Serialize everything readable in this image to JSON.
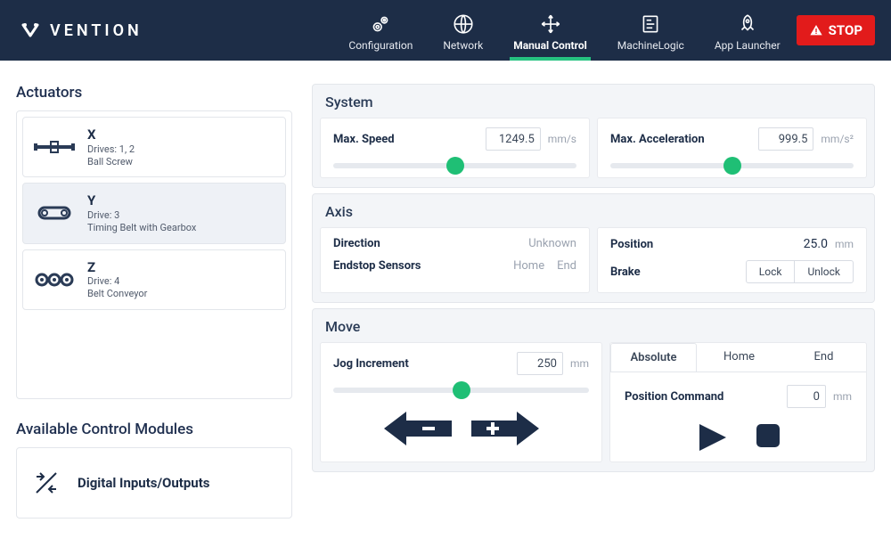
{
  "header": {
    "brand": "VENTION",
    "nav": [
      {
        "id": "configuration",
        "label": "Configuration"
      },
      {
        "id": "network",
        "label": "Network"
      },
      {
        "id": "manual",
        "label": "Manual Control",
        "active": true
      },
      {
        "id": "machinelogic",
        "label": "MachineLogic"
      },
      {
        "id": "applauncher",
        "label": "App Launcher"
      }
    ],
    "stop_label": "STOP"
  },
  "sidebar": {
    "actuators_title": "Actuators",
    "actuators": [
      {
        "name": "X",
        "drives": "Drives: 1, 2",
        "type": "Ball Screw",
        "icon": "ballscrew",
        "selected": false
      },
      {
        "name": "Y",
        "drives": "Drive: 3",
        "type": "Timing Belt with Gearbox",
        "icon": "belt",
        "selected": true
      },
      {
        "name": "Z",
        "drives": "Drive: 4",
        "type": "Belt Conveyor",
        "icon": "conveyor",
        "selected": false
      }
    ],
    "modules_title": "Available Control Modules",
    "modules": [
      {
        "label": "Digital Inputs/Outputs",
        "icon": "dio"
      }
    ]
  },
  "system": {
    "title": "System",
    "max_speed_label": "Max. Speed",
    "max_speed_value": "1249.5",
    "max_speed_unit": "mm/s",
    "max_speed_slider_pct": 50,
    "max_accel_label": "Max. Acceleration",
    "max_accel_value": "999.5",
    "max_accel_unit": "mm/s²",
    "max_accel_slider_pct": 50
  },
  "axis": {
    "title": "Axis",
    "direction_label": "Direction",
    "direction_value": "Unknown",
    "endstop_label": "Endstop Sensors",
    "endstop_home": "Home",
    "endstop_end": "End",
    "position_label": "Position",
    "position_value": "25.0",
    "position_unit": "mm",
    "brake_label": "Brake",
    "brake_lock": "Lock",
    "brake_unlock": "Unlock"
  },
  "move": {
    "title": "Move",
    "jog_label": "Jog Increment",
    "jog_value": "250",
    "jog_unit": "mm",
    "jog_slider_pct": 50,
    "tabs": [
      "Absolute",
      "Home",
      "End"
    ],
    "active_tab": "Absolute",
    "pos_cmd_label": "Position Command",
    "pos_cmd_value": "0",
    "pos_cmd_unit": "mm"
  }
}
